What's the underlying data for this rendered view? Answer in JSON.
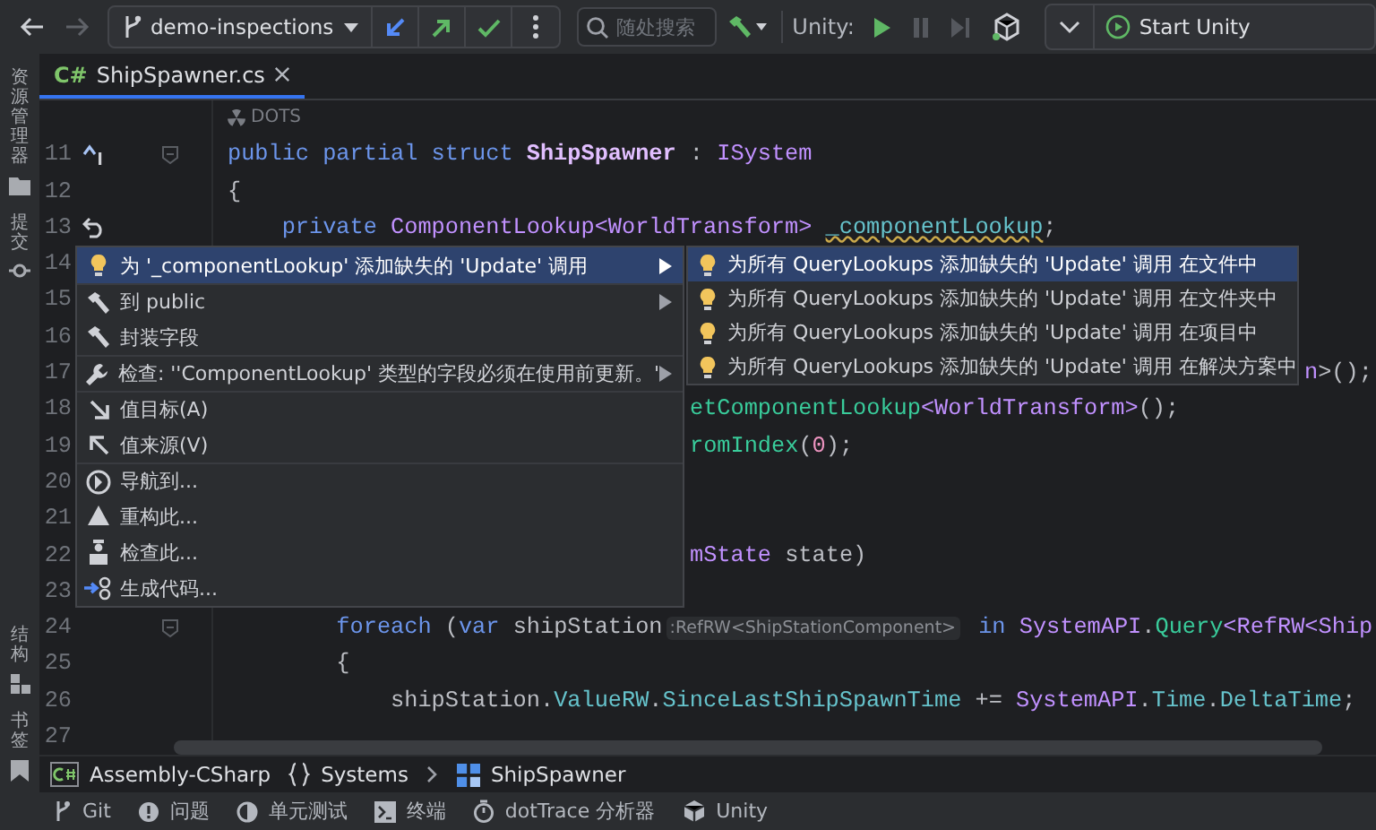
{
  "toolbar": {
    "nav": {
      "back_disabled": false,
      "forward_disabled": true
    },
    "branch": "demo-inspections",
    "search": {
      "placeholder": "随处搜索"
    },
    "unity_label": "Unity:",
    "unity_controls": [
      {
        "kind": "play",
        "disabled": false
      },
      {
        "kind": "pause",
        "disabled": true
      },
      {
        "kind": "step",
        "disabled": true
      }
    ],
    "run_config": "Start Unity"
  },
  "left_strip": {
    "top": [
      {
        "kind": "folder",
        "label": "资源管理器"
      },
      {
        "kind": "commit",
        "label": "提交"
      }
    ],
    "bottom": [
      {
        "kind": "structure",
        "label": "结构"
      },
      {
        "kind": "bookmark",
        "label": "书签"
      }
    ]
  },
  "tabs": [
    {
      "lang": "C#",
      "label": "ShipSpawner.cs",
      "selected": true
    }
  ],
  "editor": {
    "code_lens": "DOTS",
    "lines": [
      {
        "number": "11",
        "marker": {
          "kind": "implements"
        },
        "fold": true,
        "tokens": [
          {
            "kind": "keyword",
            "text": "public partial struct "
          },
          {
            "kind": "struct",
            "text": "ShipSpawner"
          },
          {
            "kind": "plain",
            "text": " : "
          },
          {
            "kind": "type",
            "text": "ISystem"
          }
        ]
      },
      {
        "number": "12",
        "tokens": [
          {
            "kind": "plain",
            "text": "{"
          }
        ]
      },
      {
        "number": "13",
        "marker": {
          "kind": "revert"
        },
        "tokens": [
          {
            "kind": "keyword",
            "text": "    private "
          },
          {
            "kind": "type",
            "text": "ComponentLookup<WorldTransform> "
          },
          {
            "kind": "field-warning",
            "text": "_componentLookup"
          },
          {
            "kind": "plain",
            "text": ";"
          }
        ]
      },
      {
        "number": "14"
      },
      {
        "number": "15"
      },
      {
        "number": "16"
      },
      {
        "number": "17",
        "covered_by": {
          "kind": "submenu"
        },
        "tokens": [
          {
            "kind": "type",
            "text": "n"
          },
          {
            "kind": "plain",
            "text": ">();"
          }
        ]
      },
      {
        "number": "18",
        "covered_by": {
          "kind": "menu"
        },
        "tokens": [
          {
            "kind": "method",
            "text": "etComponentLookup"
          },
          {
            "kind": "type",
            "text": "<WorldTransform>"
          },
          {
            "kind": "plain",
            "text": "();"
          }
        ]
      },
      {
        "number": "19",
        "covered_by": {
          "kind": "menu"
        },
        "tokens": [
          {
            "kind": "method",
            "text": "romIndex"
          },
          {
            "kind": "plain",
            "text": "("
          },
          {
            "kind": "number",
            "text": "0"
          },
          {
            "kind": "plain",
            "text": ");"
          }
        ]
      },
      {
        "number": "20"
      },
      {
        "number": "21"
      },
      {
        "number": "22",
        "covered_by": {
          "kind": "menu"
        },
        "tokens": [
          {
            "kind": "type",
            "text": "mState"
          },
          {
            "kind": "plain",
            "text": " state)"
          }
        ]
      },
      {
        "number": "23"
      },
      {
        "number": "24",
        "fold": true,
        "tokens": [
          {
            "kind": "keyword",
            "text": "        foreach"
          },
          {
            "kind": "plain",
            "text": " ("
          },
          {
            "kind": "keyword",
            "text": "var"
          },
          {
            "kind": "plain",
            "text": " shipStation"
          },
          {
            "kind": "hint",
            "text": ":RefRW<ShipStationComponent>"
          },
          {
            "kind": "keyword",
            "text": " in "
          },
          {
            "kind": "type",
            "text": "SystemAPI"
          },
          {
            "kind": "plain",
            "text": "."
          },
          {
            "kind": "method",
            "text": "Query"
          },
          {
            "kind": "type",
            "text": "<RefRW<Ship"
          }
        ]
      },
      {
        "number": "25",
        "tokens": [
          {
            "kind": "plain",
            "text": "        {"
          }
        ]
      },
      {
        "number": "26",
        "tokens": [
          {
            "kind": "plain",
            "text": "            shipStation."
          },
          {
            "kind": "field",
            "text": "ValueRW"
          },
          {
            "kind": "plain",
            "text": "."
          },
          {
            "kind": "field",
            "text": "SinceLastShipSpawnTime"
          },
          {
            "kind": "plain",
            "text": " += "
          },
          {
            "kind": "type",
            "text": "SystemAPI"
          },
          {
            "kind": "plain",
            "text": "."
          },
          {
            "kind": "field",
            "text": "Time"
          },
          {
            "kind": "plain",
            "text": "."
          },
          {
            "kind": "field",
            "text": "DeltaTime"
          },
          {
            "kind": "plain",
            "text": ";"
          }
        ]
      },
      {
        "number": "27"
      }
    ]
  },
  "context_menu": {
    "items": [
      {
        "kind": "bulb",
        "label": "为 '_componentLookup' 添加缺失的 'Update' 调用",
        "submenu": true,
        "selected": true,
        "separator_before": false
      },
      {
        "kind": "hammer",
        "label": "到 public",
        "submenu": true,
        "selected": false,
        "separator_before": true
      },
      {
        "kind": "hammer",
        "label": "封装字段",
        "submenu": false,
        "selected": false,
        "separator_before": false
      },
      {
        "kind": "wrench",
        "label": "检查: ''ComponentLookup' 类型的字段必须在使用前更新。'",
        "submenu": true,
        "selected": false,
        "separator_before": true
      },
      {
        "kind": "arrow-down",
        "label": "值目标(A)",
        "submenu": false,
        "selected": false,
        "separator_before": true
      },
      {
        "kind": "arrow-up",
        "label": "值来源(V)",
        "submenu": false,
        "selected": false,
        "separator_before": false
      },
      {
        "kind": "compass",
        "label": "导航到...",
        "submenu": false,
        "selected": false,
        "separator_before": true
      },
      {
        "kind": "pyramid",
        "label": "重构此...",
        "submenu": false,
        "selected": false,
        "separator_before": false
      },
      {
        "kind": "inspector",
        "label": "检查此...",
        "submenu": false,
        "selected": false,
        "separator_before": false
      },
      {
        "kind": "generate",
        "label": "生成代码...",
        "submenu": false,
        "selected": false,
        "separator_before": false
      }
    ]
  },
  "submenu": {
    "items": [
      {
        "label": "为所有 QueryLookups 添加缺失的 'Update' 调用 在文件中",
        "selected": true
      },
      {
        "label": "为所有 QueryLookups 添加缺失的 'Update' 调用 在文件夹中",
        "selected": false
      },
      {
        "label": "为所有 QueryLookups 添加缺失的 'Update' 调用 在项目中",
        "selected": false
      },
      {
        "label": "为所有 QueryLookups 添加缺失的 'Update' 调用 在解决方案中",
        "selected": false
      }
    ]
  },
  "breadcrumb": [
    {
      "kind": "assembly",
      "label": "Assembly-CSharp",
      "separator_before": false
    },
    {
      "kind": "namespace",
      "label": "Systems",
      "separator_before": false
    },
    {
      "kind": "class",
      "label": "ShipSpawner",
      "separator_before": true
    }
  ],
  "status_bar": [
    {
      "kind": "git",
      "label": "Git"
    },
    {
      "kind": "problems",
      "label": "问题"
    },
    {
      "kind": "tests",
      "label": "单元测试"
    },
    {
      "kind": "terminal",
      "label": "终端"
    },
    {
      "kind": "profiler",
      "label": "dotTrace 分析器"
    },
    {
      "kind": "unity",
      "label": "Unity"
    }
  ]
}
